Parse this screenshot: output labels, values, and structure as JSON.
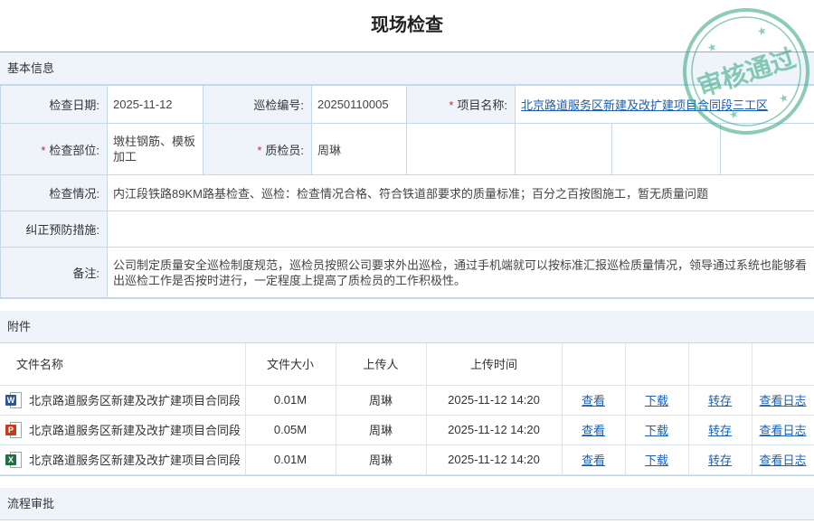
{
  "title": "现场检查",
  "stamp_text": "审核通过",
  "sections": {
    "basic": "基本信息",
    "attachments": "附件",
    "workflow": "流程审批"
  },
  "form": {
    "date_label": "检查日期:",
    "date_value": "2025-11-12",
    "patrol_no_label": "巡检编号:",
    "patrol_no_value": "20250110005",
    "project_label": "项目名称:",
    "project_value": "北京路道服务区新建及改扩建项目合同段三工区",
    "part_label": "检查部位:",
    "part_value": "墩柱钢筋、模板加工",
    "inspector_label": "质检员:",
    "inspector_value": "周琳",
    "situation_label": "检查情况:",
    "situation_value": "内江段铁路89KM路基检查、巡检：检查情况合格、符合铁道部要求的质量标准；百分之百按图施工，暂无质量问题",
    "corrective_label": "纠正预防措施:",
    "corrective_value": "",
    "remark_label": "备注:",
    "remark_value": "公司制定质量安全巡检制度规范，巡检员按照公司要求外出巡检，通过手机端就可以按标准汇报巡检质量情况，领导通过系统也能够看出巡检工作是否按时进行，一定程度上提高了质检员的工作积极性。"
  },
  "files": {
    "headers": {
      "name": "文件名称",
      "size": "文件大小",
      "uploader": "上传人",
      "time": "上传时间"
    },
    "actions": {
      "view": "查看",
      "download": "下载",
      "save": "转存",
      "log": "查看日志"
    },
    "rows": [
      {
        "icon": "word-file-icon",
        "badge": "W",
        "name": "北京路道服务区新建及改扩建项目合同段",
        "size": "0.01M",
        "uploader": "周琳",
        "time": "2025-11-12 14:20"
      },
      {
        "icon": "powerpoint-file-icon",
        "badge": "P",
        "name": "北京路道服务区新建及改扩建项目合同段",
        "size": "0.05M",
        "uploader": "周琳",
        "time": "2025-11-12 14:20"
      },
      {
        "icon": "excel-file-icon",
        "badge": "X",
        "name": "北京路道服务区新建及改扩建项目合同段",
        "size": "0.01M",
        "uploader": "周琳",
        "time": "2025-11-12 14:20"
      }
    ]
  },
  "colors": {
    "stamp": "#2fa37a",
    "link": "#1a5fb4",
    "required": "#e02020",
    "label_bg": "#eef4fa"
  }
}
